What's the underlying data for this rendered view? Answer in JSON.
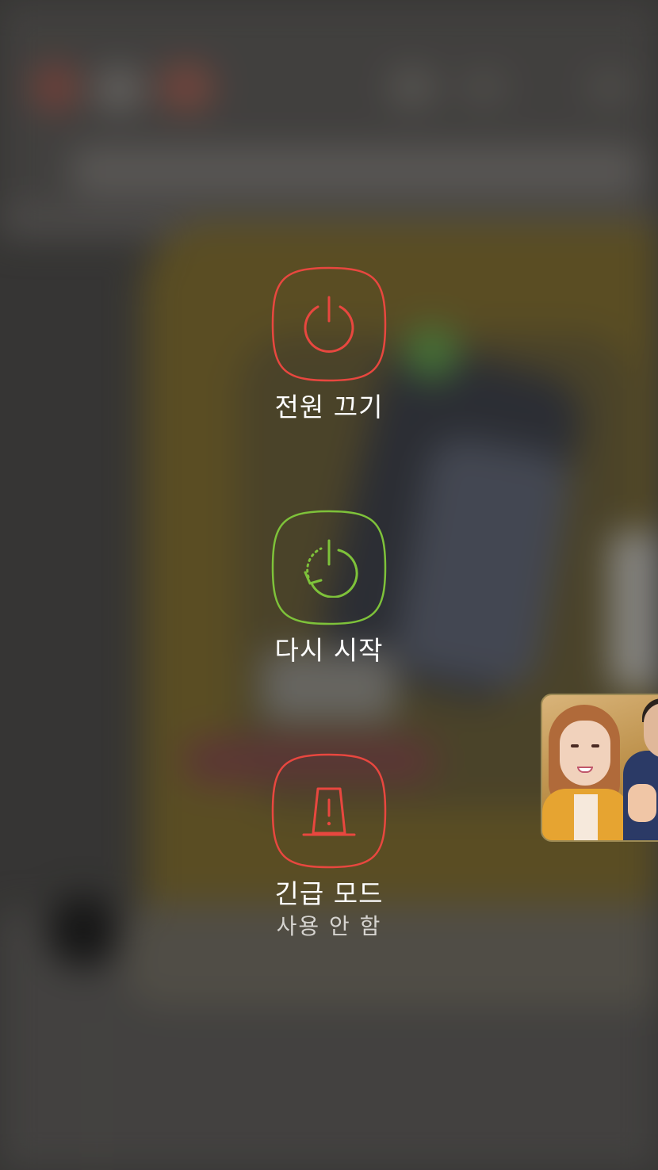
{
  "power_menu": {
    "items": [
      {
        "id": "power-off",
        "label": "전원 끄기",
        "icon": "power-icon",
        "color": "#e8473f"
      },
      {
        "id": "restart",
        "label": "다시 시작",
        "icon": "restart-icon",
        "color": "#7ec23a"
      },
      {
        "id": "emergency-mode",
        "label": "긴급 모드",
        "sublabel": "사용 안 함",
        "icon": "emergency-light-icon",
        "color": "#e8473f"
      }
    ]
  },
  "pip_video": {
    "icon": "video-thumbnail"
  },
  "colors": {
    "danger": "#e8473f",
    "success": "#7ec23a",
    "text": "#ffffff",
    "subtext": "#d6d4d0"
  }
}
